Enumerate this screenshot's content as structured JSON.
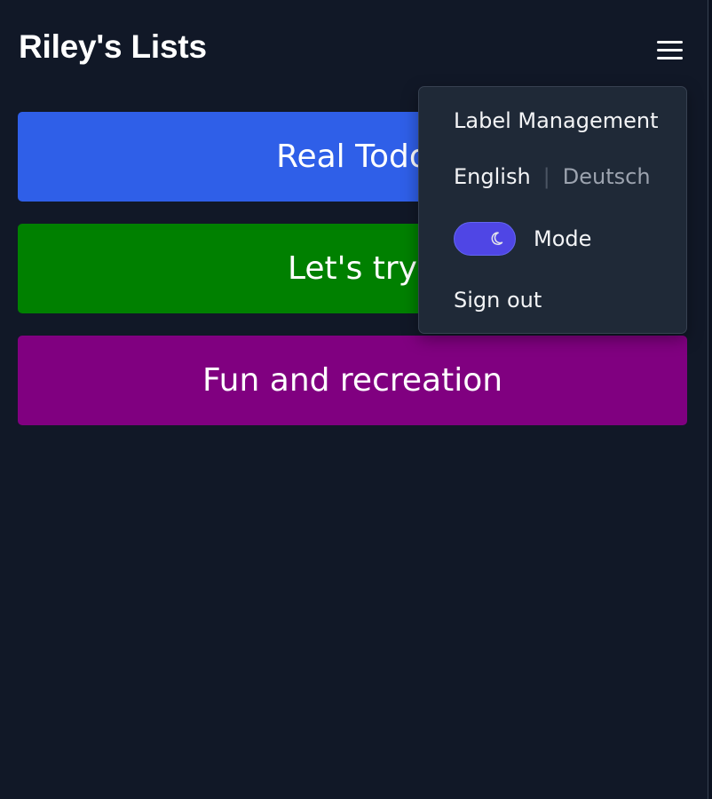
{
  "header": {
    "title": "Riley's Lists",
    "menu_icon": "hamburger-icon"
  },
  "lists": [
    {
      "name": "Real Todo",
      "color": "#2f5fe8"
    },
    {
      "name": "Let's try",
      "color": "#008000"
    },
    {
      "name": "Fun and recreation",
      "color": "#800080"
    }
  ],
  "menu": {
    "label_management": "Label Management",
    "languages": {
      "active": "English",
      "separator": "|",
      "inactive": "Deutsch"
    },
    "mode": {
      "label": "Mode",
      "icon": "moon-icon",
      "state": "dark"
    },
    "sign_out": "Sign out"
  },
  "colors": {
    "background": "#111827",
    "menu_background": "#1f2937",
    "toggle": "#4f46e5"
  }
}
